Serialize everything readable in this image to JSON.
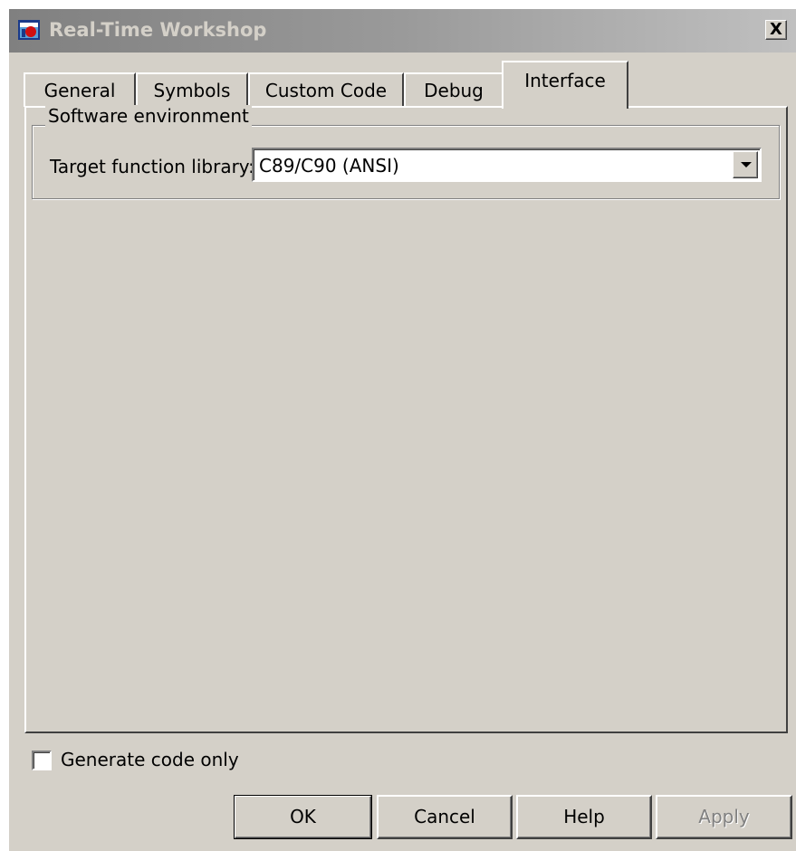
{
  "window": {
    "title": "Real-Time Workshop",
    "close_glyph": "X",
    "icon": "real-time-workshop-icon"
  },
  "tabs": [
    {
      "label": "General",
      "active": false
    },
    {
      "label": "Symbols",
      "active": false
    },
    {
      "label": "Custom Code",
      "active": false
    },
    {
      "label": "Debug",
      "active": false
    },
    {
      "label": "Interface",
      "active": true
    }
  ],
  "software_environment": {
    "legend": "Software environment",
    "target_function_library_label": "Target function library:",
    "target_function_library_value": "C89/C90 (ANSI)"
  },
  "generate_code_only": {
    "label": "Generate code only",
    "checked": false
  },
  "buttons": {
    "ok": "OK",
    "cancel": "Cancel",
    "help": "Help",
    "apply": "Apply"
  },
  "colors": {
    "dialog_face": "#d4d0c8",
    "title_inactive_start": "#808080",
    "title_inactive_end": "#c0c0c0",
    "disabled_text": "#808080"
  }
}
